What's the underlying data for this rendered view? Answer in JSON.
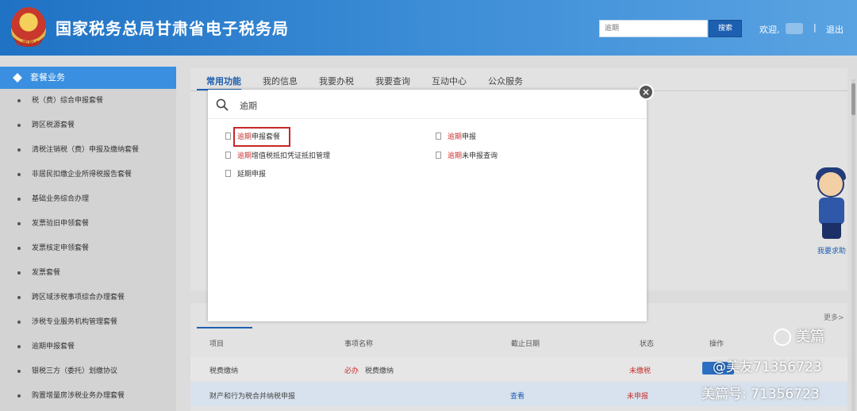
{
  "header": {
    "site_title": "国家税务总局甘肃省电子税务局",
    "search_placeholder": "逾期",
    "search_button": "搜索",
    "welcome": "欢迎,",
    "separator": "|",
    "logout": "退出",
    "emblem_text": "中国税务"
  },
  "sidebar": {
    "heading": "套餐业务",
    "items": [
      "税（费）综合申报套餐",
      "跨区税源套餐",
      "清税注销税（费）申报及缴纳套餐",
      "非居民扣缴企业所得税报告套餐",
      "基础业务综合办理",
      "发票验旧申领套餐",
      "发票核定申领套餐",
      "发票套餐",
      "跨区域涉税事项综合办理套餐",
      "涉税专业服务机构管理套餐",
      "逾期申报套餐",
      "银税三方（委托）划缴协议",
      "购置增量房涉税业务办理套餐"
    ]
  },
  "tabs": [
    "常用功能",
    "我的信息",
    "我要办税",
    "我要查询",
    "互动中心",
    "公众服务"
  ],
  "help_label": "我要求助",
  "more_label": "更多>",
  "table": {
    "headers": [
      "项目",
      "事项名称",
      "截止日期",
      "状态",
      "操作"
    ],
    "rows": [
      {
        "item": "税费缴纳",
        "tag": "必办",
        "name": "税费缴纳",
        "deadline": "",
        "status": "未缴税"
      },
      {
        "item": "财产和行为税合并纳税申报",
        "tag": "",
        "name": "",
        "deadline": "查看",
        "status": "未申报"
      }
    ]
  },
  "modal": {
    "query": "逾期",
    "close": "×",
    "results": [
      {
        "hl": "逾期",
        "rest": "申报套餐"
      },
      {
        "hl": "逾期",
        "rest": "申报"
      },
      {
        "hl": "逾期",
        "rest": "增值税抵扣凭证抵扣管理"
      },
      {
        "hl": "逾期",
        "rest": "未申报查询"
      },
      {
        "hl": "",
        "rest": "延期申报"
      }
    ]
  },
  "watermark": {
    "brand": "美篇",
    "user": "@美友71356723",
    "id": "美篇号: 71356723"
  }
}
